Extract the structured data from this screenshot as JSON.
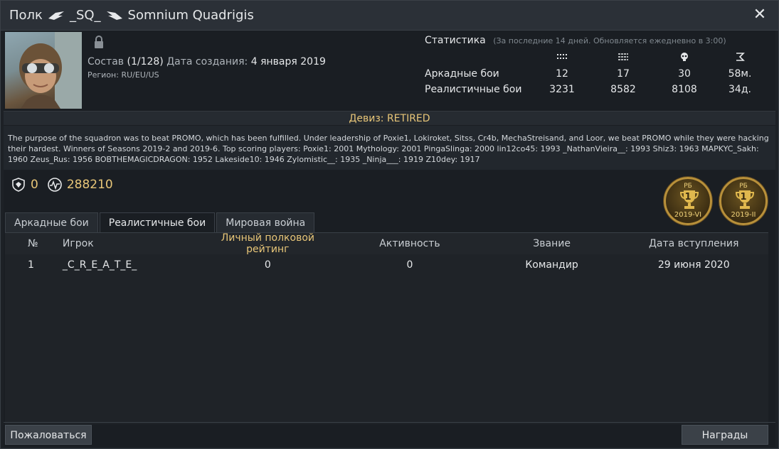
{
  "window": {
    "title_prefix": "Полк",
    "tag": "_SQ_",
    "name": "Somnium Quadrigis",
    "close_icon": "close-icon"
  },
  "info": {
    "members_label": "Состав",
    "members_value": "(1/128)",
    "created_label": "Дата создания:",
    "created_value": "4 января 2019",
    "region_label": "Регион:",
    "region_value": "RU/EU/US"
  },
  "stats": {
    "title": "Статистика",
    "subtitle": "(За последние 14 дней. Обновляется ежедневно в 3:00)",
    "icons": [
      "air-kills-icon",
      "ground-kills-icon",
      "deaths-icon",
      "time-icon"
    ],
    "rows": [
      {
        "label": "Аркадные бои",
        "values": [
          "12",
          "17",
          "30",
          "58м."
        ]
      },
      {
        "label": "Реалистичные бои",
        "values": [
          "3231",
          "8582",
          "8108",
          "34д."
        ]
      }
    ]
  },
  "motto": "Девиз: RETIRED",
  "description": "The purpose of the squadron was to beat PROMO, which has been fulfilled. Under leadership of Poxie1, Lokiroket, Sitss, Cr4b, MechaStreisand, and Loor, we beat PROMO while they were hacking their hardest. Winners of Seasons 2019-2 and 2019-6. Top scoring players: Poxie1: 2001 Mythology: 2001 PingaSlinga: 2000 lin12co45: 1993 _NathanVieira__: 1993 Shiz3: 1963 MAPKYC_Sakh: 1960 Zeus_Rus: 1956 BOBTHEMAGICDRAGON: 1952 Lakeside10: 1946 Zylomistic__: 1935 _Ninja___: 1919 Z10dey: 1917",
  "rating": {
    "points": "0",
    "activity": "288210"
  },
  "medals": [
    {
      "mode": "РБ",
      "place": "1",
      "season": "2019-VI"
    },
    {
      "mode": "РБ",
      "place": "1",
      "season": "2019-II"
    }
  ],
  "tabs": [
    "Аркадные бои",
    "Реалистичные бои",
    "Мировая война"
  ],
  "table": {
    "headers": [
      "№",
      "Игрок",
      "Личный полковой рейтинг",
      "Активность",
      "Звание",
      "Дата вступления"
    ],
    "rows": [
      [
        "1",
        "_C_R_E_A_T_E_",
        "0",
        "0",
        "Командир",
        "29 июня 2020"
      ]
    ]
  },
  "buttons": {
    "report": "Пожаловаться",
    "awards": "Награды"
  },
  "colors": {
    "accent_gold": "#e8c678",
    "background": "#1a1e23"
  }
}
